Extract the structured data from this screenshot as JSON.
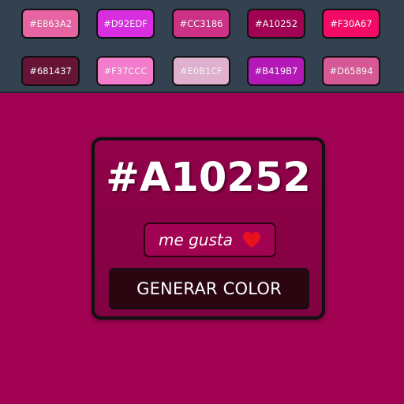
{
  "background_color": "#A10252",
  "palette": [
    {
      "hex": "#E863A2",
      "label": "#E863A2"
    },
    {
      "hex": "#D92EDF",
      "label": "#D92EDF"
    },
    {
      "hex": "#CC3186",
      "label": "#CC3186"
    },
    {
      "hex": "#A10252",
      "label": "#A10252"
    },
    {
      "hex": "#F30A67",
      "label": "#F30A67"
    },
    {
      "hex": "#681437",
      "label": "#681437"
    },
    {
      "hex": "#F37CCC",
      "label": "#F37CCC"
    },
    {
      "hex": "#E0B1CF",
      "label": "#E0B1CF"
    },
    {
      "hex": "#B419B7",
      "label": "#B419B7"
    },
    {
      "hex": "#D65894",
      "label": "#D65894"
    }
  ],
  "card": {
    "current_hex": "#A10252",
    "like_label": "me gusta",
    "like_icon": "heart-icon",
    "like_icon_color": "#E8101C",
    "generate_label": "GENERAR COLOR"
  }
}
